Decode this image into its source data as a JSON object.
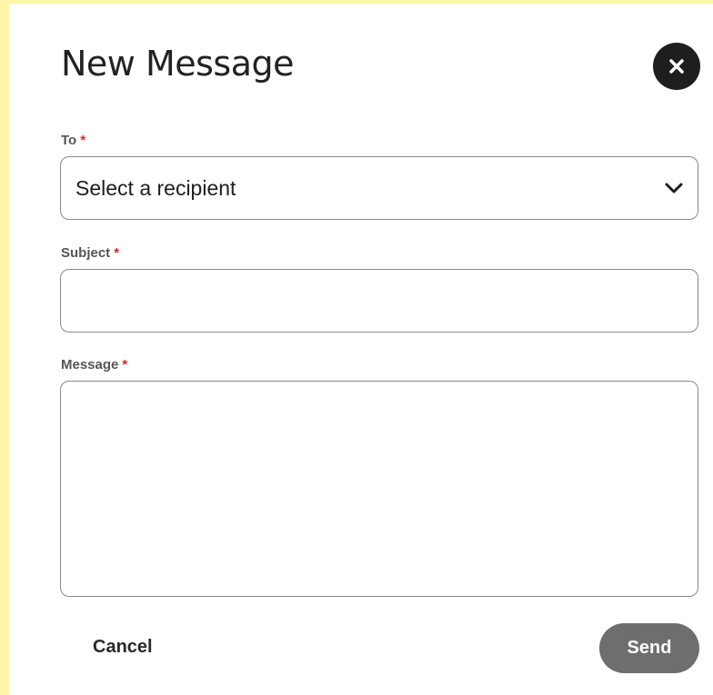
{
  "dialog": {
    "title": "New Message",
    "close_icon": "close-icon"
  },
  "form": {
    "to": {
      "label": "To",
      "required_marker": "*",
      "selected_value": "Select a recipient",
      "icon": "chevron-down-icon"
    },
    "subject": {
      "label": "Subject",
      "required_marker": "*",
      "value": ""
    },
    "message": {
      "label": "Message",
      "required_marker": "*",
      "value": ""
    }
  },
  "actions": {
    "cancel_label": "Cancel",
    "send_label": "Send"
  },
  "colors": {
    "required": "#d8262c",
    "send_button": "#6e6e6e",
    "close_button": "#1e1e1e",
    "frame_highlight": "#fdf5a8"
  }
}
